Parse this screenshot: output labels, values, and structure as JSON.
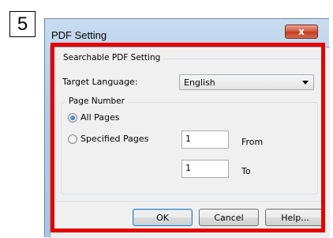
{
  "step": "5",
  "window": {
    "title": "PDF Setting",
    "close_label": "x"
  },
  "searchable": {
    "legend": "Searchable PDF Setting",
    "target_language_label": "Target Language:",
    "target_language_value": "English"
  },
  "page_number": {
    "legend": "Page Number",
    "all_pages_label": "All Pages",
    "specified_pages_label": "Specified Pages",
    "from_value": "1",
    "from_label": "From",
    "to_value": "1",
    "to_label": "To"
  },
  "buttons": {
    "ok": "OK",
    "cancel": "Cancel",
    "help": "Help..."
  },
  "colors": {
    "highlight": "#e60000"
  }
}
